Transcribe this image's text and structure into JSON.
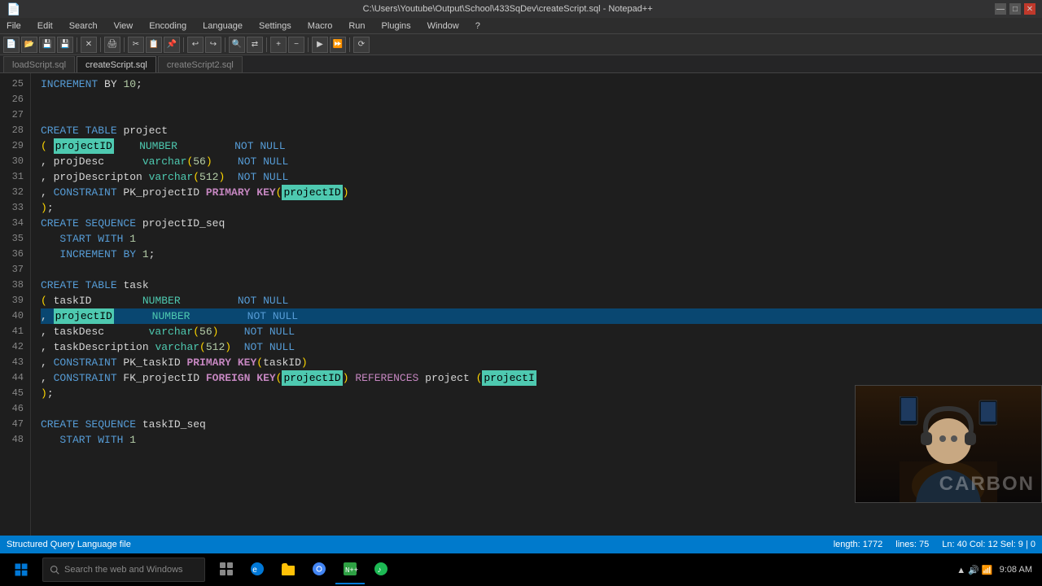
{
  "titleBar": {
    "title": "C:\\Users\\Youtube\\Output\\School\\433SqDev\\createScript.sql - Notepad++",
    "controls": [
      "—",
      "□",
      "✕"
    ]
  },
  "menuBar": {
    "items": [
      "File",
      "Edit",
      "Search",
      "View",
      "Encoding",
      "Language",
      "Settings",
      "Macro",
      "Run",
      "Plugins",
      "Window",
      "?"
    ]
  },
  "tabs": [
    {
      "label": "loadScript.sql",
      "active": false
    },
    {
      "label": "createScript.sql",
      "active": true
    },
    {
      "label": "createScript2.sql",
      "active": false
    }
  ],
  "statusBar": {
    "left": "Structured Query Language file",
    "length": "length: 1772",
    "lines": "lines: 75",
    "position": "Ln: 40  Col: 12  Sel: 9 | 0"
  },
  "taskbar": {
    "searchPlaceholder": "Search the web and Windows",
    "time": "9:08 AM"
  },
  "codeLines": [
    {
      "num": 25,
      "content": "INCREMENT BY 10;",
      "highlighted": false
    },
    {
      "num": 26,
      "content": "",
      "highlighted": false
    },
    {
      "num": 27,
      "content": "",
      "highlighted": false
    },
    {
      "num": 28,
      "content": "CREATE TABLE project",
      "highlighted": false
    },
    {
      "num": 29,
      "content": "( projectID    NUMBER         NOT NULL",
      "highlighted": false
    },
    {
      "num": 30,
      "content": ", projDesc      varchar(56)    NOT NULL",
      "highlighted": false
    },
    {
      "num": 31,
      "content": ", projDescripton varchar(512)  NOT NULL",
      "highlighted": false
    },
    {
      "num": 32,
      "content": ", CONSTRAINT PK_projectID PRIMARY KEY(projectID)",
      "highlighted": false
    },
    {
      "num": 33,
      "content": ");",
      "highlighted": false
    },
    {
      "num": 34,
      "content": "CREATE SEQUENCE projectID_seq",
      "highlighted": false
    },
    {
      "num": 35,
      "content": "   START WITH 1",
      "highlighted": false
    },
    {
      "num": 36,
      "content": "   INCREMENT BY 1;",
      "highlighted": false
    },
    {
      "num": 37,
      "content": "",
      "highlighted": false
    },
    {
      "num": 38,
      "content": "CREATE TABLE task",
      "highlighted": false
    },
    {
      "num": 39,
      "content": "( taskID        NUMBER         NOT NULL",
      "highlighted": false
    },
    {
      "num": 40,
      "content": ", projectID      NUMBER         NOT NULL",
      "highlighted": true
    },
    {
      "num": 41,
      "content": ", taskDesc       varchar(56)    NOT NULL",
      "highlighted": false
    },
    {
      "num": 42,
      "content": ", taskDescription varchar(512)  NOT NULL",
      "highlighted": false
    },
    {
      "num": 43,
      "content": ", CONSTRAINT PK_taskID PRIMARY KEY(taskID)",
      "highlighted": false
    },
    {
      "num": 44,
      "content": ", CONSTRAINT FK_projectID FOREIGN KEY(projectID) REFERENCES project (projectI",
      "highlighted": false
    },
    {
      "num": 45,
      "content": ");",
      "highlighted": false
    },
    {
      "num": 46,
      "content": "",
      "highlighted": false
    },
    {
      "num": 47,
      "content": "CREATE SEQUENCE taskID_seq",
      "highlighted": false
    },
    {
      "num": 48,
      "content": "   START WITH 1",
      "highlighted": false
    }
  ]
}
